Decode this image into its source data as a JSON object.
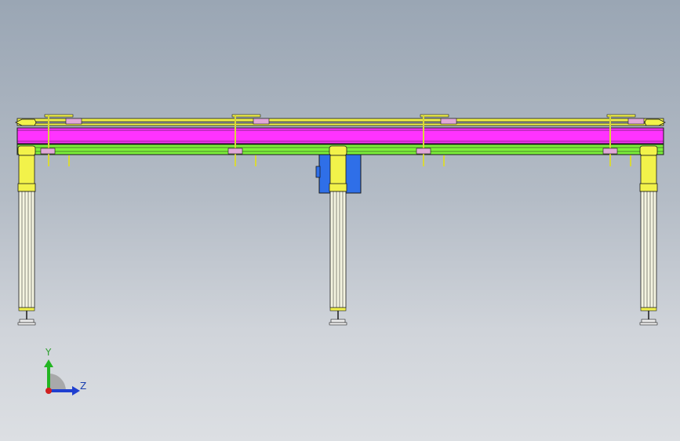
{
  "viewport": {
    "background_top": "#9aa6b4",
    "background_bottom": "#dcdfe3"
  },
  "model": {
    "colors": {
      "beam_main": "#ff33ff",
      "beam_rail": "#7cf03a",
      "hardware": "#f2f24a",
      "outline": "#1a1a1a",
      "clamp": "#e0a8d8",
      "motor": "#2f6fe8",
      "column": "#f4f4e0"
    }
  },
  "triad": {
    "y_label": "Y",
    "z_label": "Z",
    "y_color": "#22b522",
    "z_color": "#1f3fd0",
    "x_color": "#d02020"
  }
}
